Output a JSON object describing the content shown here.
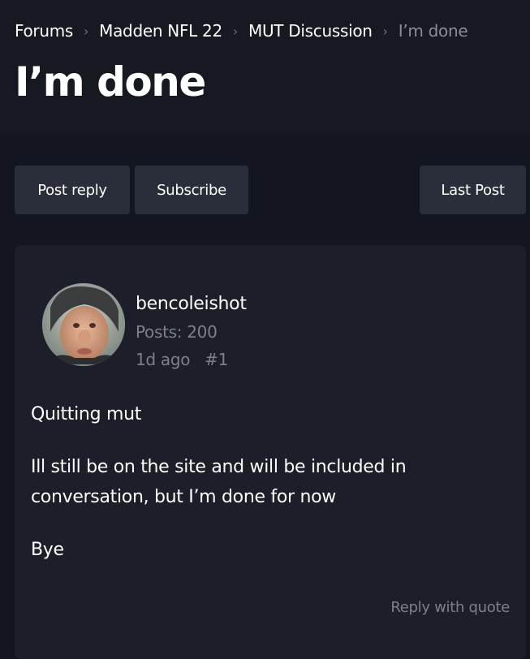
{
  "breadcrumb": {
    "items": [
      "Forums",
      "Madden NFL 22",
      "MUT Discussion",
      "I’m done"
    ],
    "separator": "›"
  },
  "thread": {
    "title": "I’m done"
  },
  "actions": {
    "post_reply": "Post reply",
    "subscribe": "Subscribe",
    "last_post": "Last Post"
  },
  "post": {
    "author": "bencoleishot",
    "posts_count": "Posts: 200",
    "time": "1d ago",
    "number": "#1",
    "paragraphs": [
      "Quitting mut",
      "Ill still be on the site and will be included in conversation, but I’m done for now",
      "Bye"
    ],
    "reply_with_quote": "Reply with quote",
    "avatar_icon": "user-photo-avatar"
  },
  "colors": {
    "background": "#131520",
    "header": "#161822",
    "button": "#2a2d3a",
    "card": "#1c1e29",
    "muted_text": "#7d808a"
  }
}
